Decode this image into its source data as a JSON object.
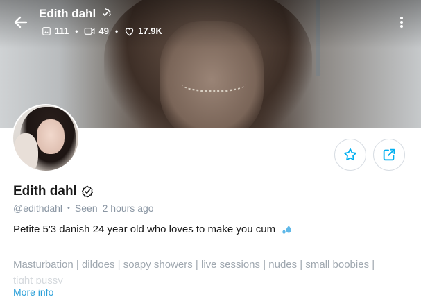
{
  "header": {
    "title": "Edith dahl",
    "stats": [
      {
        "icon": "image-icon",
        "value": "111"
      },
      {
        "icon": "video-icon",
        "value": "49"
      },
      {
        "icon": "heart-icon",
        "value": "17.9K"
      }
    ]
  },
  "profile": {
    "name": "Edith dahl",
    "handle": "@edithdahl",
    "seen_label": "Seen",
    "seen_time": "2 hours ago",
    "bio": "Petite 5'3 danish 24 year old who loves to make you cum",
    "tags": "Masturbation | dildoes | soapy showers | live sessions | nudes | small boobies |",
    "tags_overflow": "tight pussy",
    "more_info": "More info"
  },
  "colors": {
    "accent": "#00aff0",
    "muted": "#8a96a3"
  }
}
